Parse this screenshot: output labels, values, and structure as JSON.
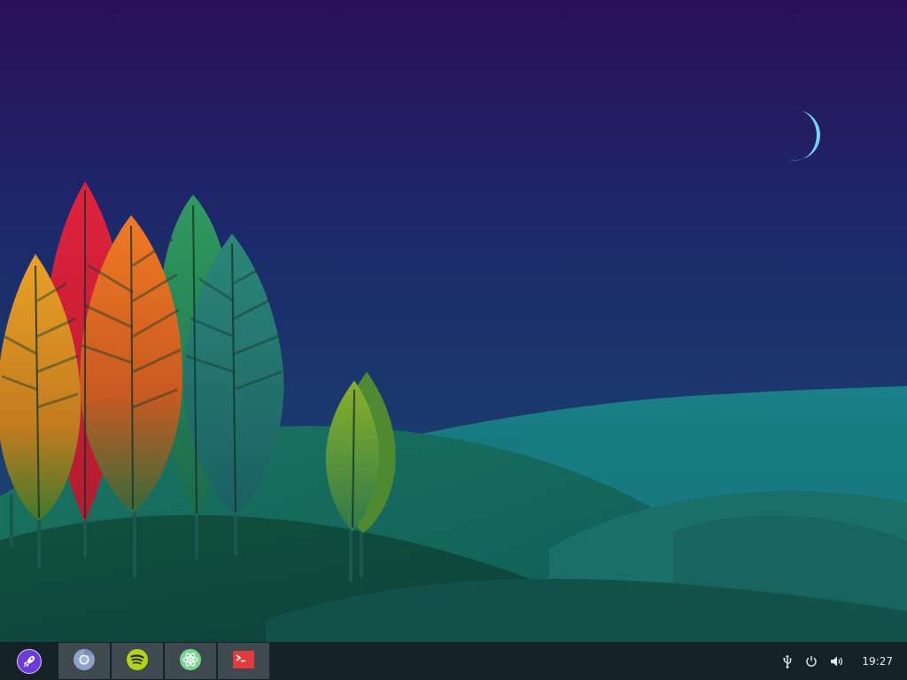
{
  "wallpaper": {
    "colors": {
      "sky_top": "#2a0f5c",
      "sky_mid": "#1c2a6b",
      "sky_bottom": "#1a3f6e",
      "moon": "#6fd6f5",
      "hill_far": "#1a7e86",
      "hill_mid": "#176a63",
      "hill_near": "#0f4a3a",
      "tree_red": "#d9263a",
      "tree_orange": "#e76a1f",
      "tree_amber": "#e09a22",
      "tree_green": "#2e8f5c",
      "tree_teal": "#246f73",
      "tree_yellow_green": "#7aa22a"
    }
  },
  "taskbar": {
    "background": "#142127",
    "launcher": {
      "icon": "rocket-launcher-icon"
    },
    "tasks": [
      {
        "name": "chromium",
        "icon": "chromium-icon",
        "color": "#8fa3c8"
      },
      {
        "name": "spotify",
        "icon": "spotify-icon",
        "color": "#b5d11a"
      },
      {
        "name": "atom",
        "icon": "atom-icon",
        "color": "#7bd58f"
      },
      {
        "name": "terminal",
        "icon": "terminal-icon",
        "color": "#e23b3b"
      }
    ],
    "tray": {
      "usb_icon": "usb-icon",
      "power_icon": "power-icon",
      "volume_icon": "volume-icon",
      "clock": "19:27"
    }
  }
}
